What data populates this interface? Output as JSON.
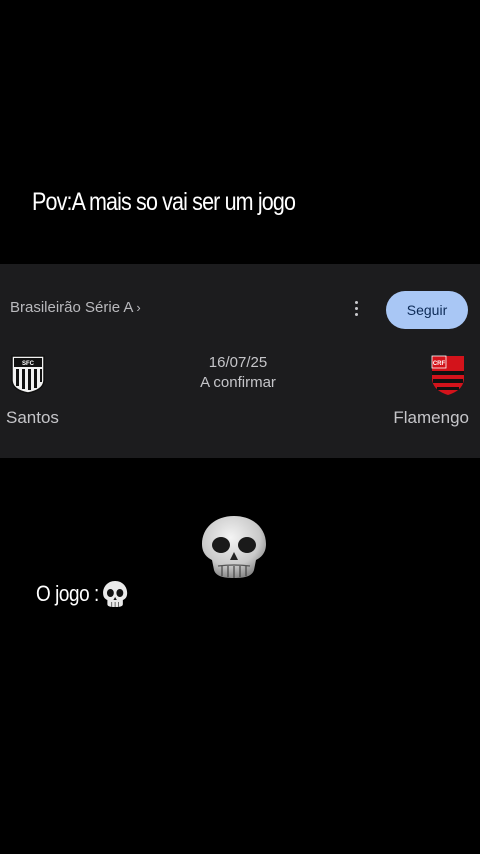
{
  "caption_top": "Pov:A mais so vai ser um jogo",
  "card": {
    "league": "Brasileirão Série A",
    "league_chevron": "›",
    "follow_label": "Seguir",
    "more_icon": "more-vert-icon",
    "match": {
      "date": "16/07/25",
      "status": "A confirmar",
      "home_team": "Santos",
      "away_team": "Flamengo"
    },
    "colors": {
      "background": "#1c1c1e",
      "follow_button": "#a9c7f5",
      "follow_text": "#0d2b57",
      "text": "#c5c5c9"
    }
  },
  "caption_bottom": "O jogo :",
  "caption_bottom_emoji": "skull-icon"
}
